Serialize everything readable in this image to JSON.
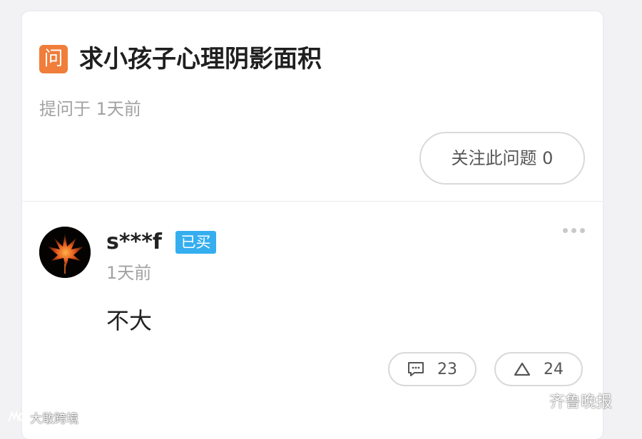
{
  "question": {
    "icon_char": "问",
    "title": "求小孩子心理阴影面积",
    "meta": "提问于 1天前",
    "follow_button": "关注此问题 0"
  },
  "answer": {
    "avatar_icon": "maple-leaf-avatar",
    "username": "s***f",
    "badge": "已买",
    "time": "1天前",
    "text": "不大",
    "comment_count": "23",
    "like_count": "24",
    "more_icon": "ellipsis-icon"
  },
  "watermarks": {
    "right": "齐鲁晚报",
    "left": "大敢跨境"
  },
  "colors": {
    "question_icon_bg": "#f07d3a",
    "badge_bg": "#35aef0",
    "title_text": "#1f1f1f",
    "meta_text": "#a2a2a2"
  }
}
